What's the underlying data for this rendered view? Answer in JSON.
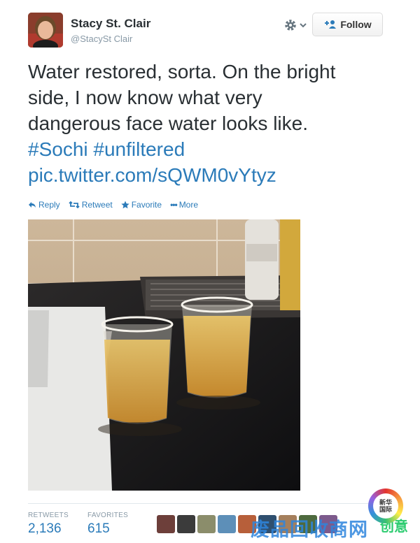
{
  "user": {
    "name": "Stacy St. Clair",
    "handle": "@StacySt Clair"
  },
  "follow": {
    "label": "Follow"
  },
  "tweet": {
    "line1": "Water restored, sorta. On the bright",
    "line2": "side, I now know what very",
    "line3": "dangerous face water looks like.",
    "hashtags": "#Sochi #unfiltered",
    "link": "pic.twitter.com/sQWM0vYtyz"
  },
  "actions": {
    "reply": "Reply",
    "retweet": "Retweet",
    "favorite": "Favorite",
    "more": "More"
  },
  "stats": {
    "retweets_label": "RETWEETS",
    "retweets_value": "2,136",
    "favorites_label": "FAVORITES",
    "favorites_value": "615"
  },
  "colors": {
    "link": "#2b7bb9",
    "text": "#292f33",
    "muted": "#8899a6"
  },
  "badge": {
    "line1": "新华",
    "line2": "国际"
  },
  "watermark": {
    "text": "废品回收商网",
    "extra": "创意"
  }
}
